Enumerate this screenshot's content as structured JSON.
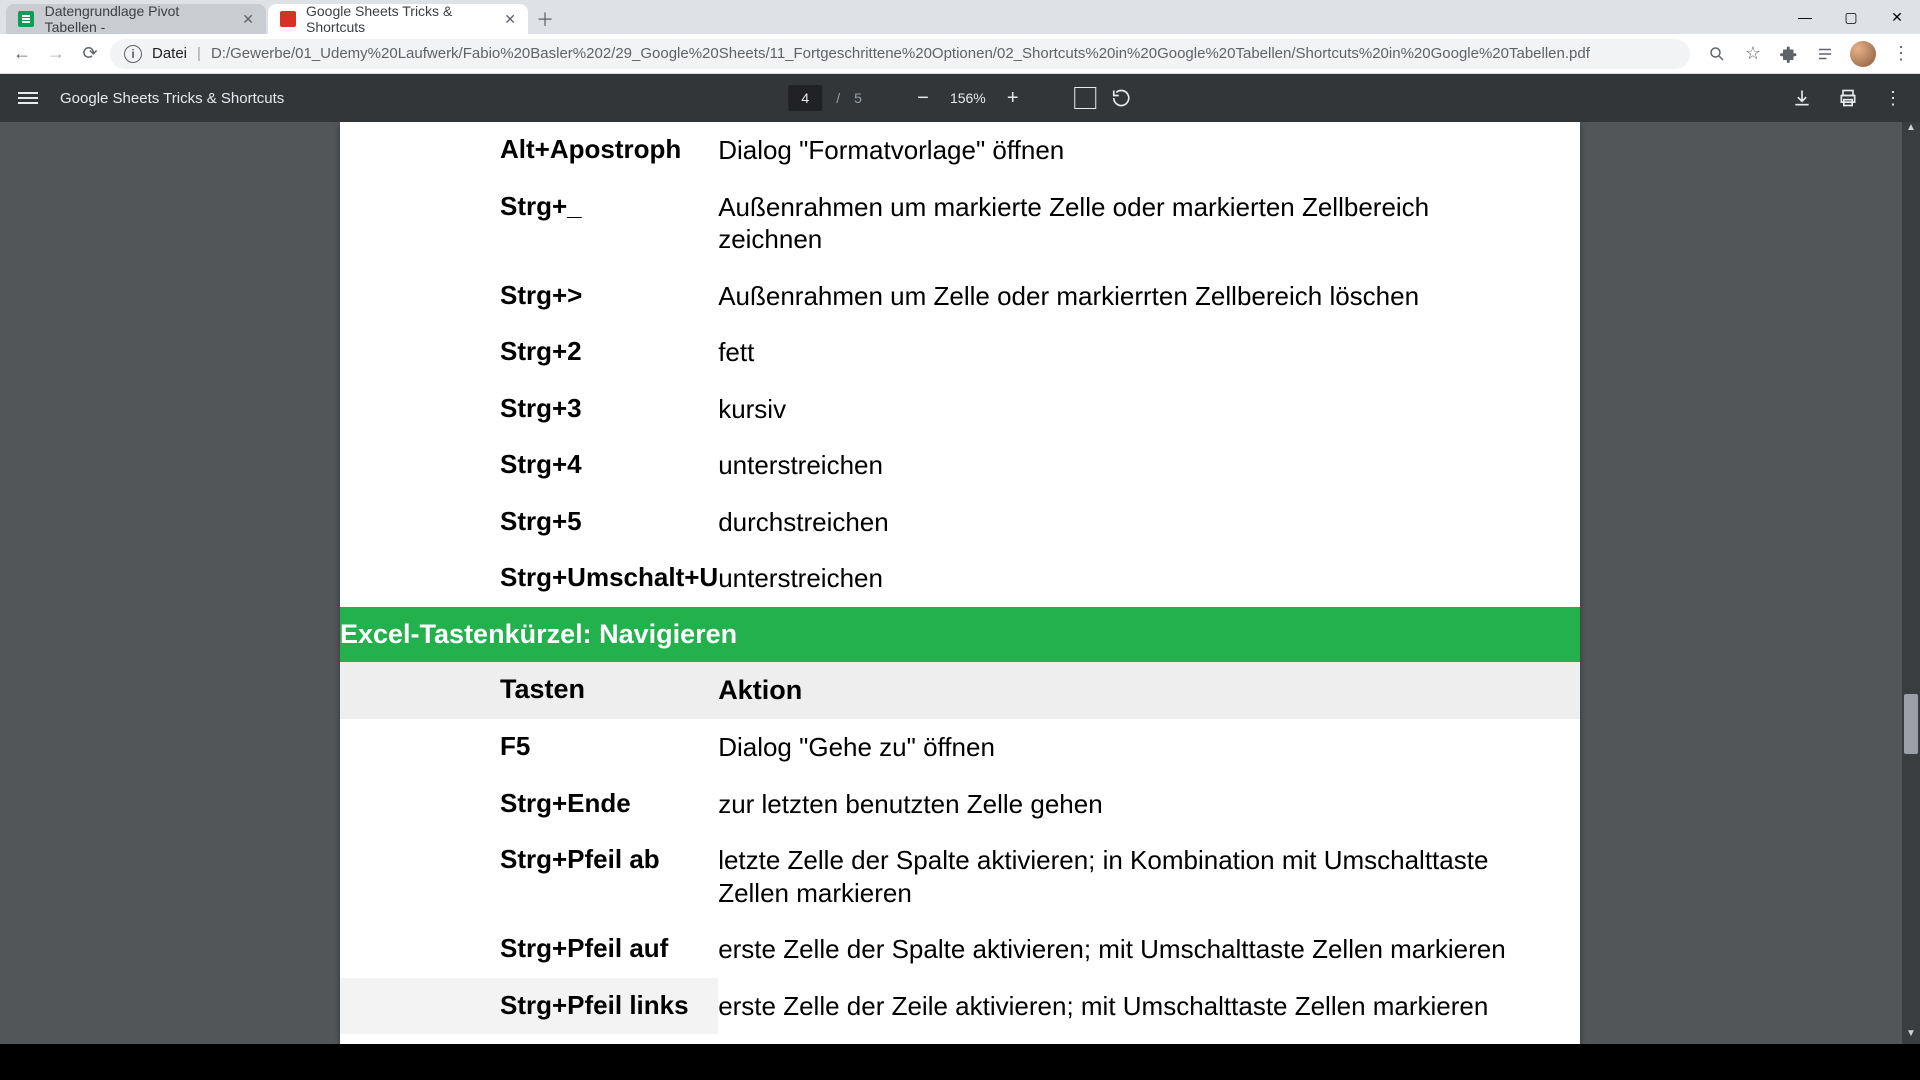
{
  "tabs": [
    {
      "title": "Datengrundlage Pivot Tabellen -",
      "active": false
    },
    {
      "title": "Google Sheets Tricks & Shortcuts",
      "active": true
    }
  ],
  "url": {
    "scheme": "Datei",
    "path": "D:/Gewerbe/01_Udemy%20Laufwerk/Fabio%20Basler%202/29_Google%20Sheets/11_Fortgeschrittene%20Optionen/02_Shortcuts%20in%20Google%20Tabellen/Shortcuts%20in%20Google%20Tabellen.pdf"
  },
  "pdf": {
    "title": "Google Sheets Tricks & Shortcuts",
    "page_current": "4",
    "page_total": "5",
    "zoom": "156%"
  },
  "rows_top": [
    {
      "key": "Alt+Apostroph",
      "desc": "Dialog \"Formatvorlage\" öffnen"
    },
    {
      "key": "Strg+_",
      "desc": "Außenrahmen um markierte Zelle oder markierten Zellbereich zeichnen"
    },
    {
      "key": "Strg+>",
      "desc": "Außenrahmen um Zelle oder markierrten Zellbereich löschen"
    },
    {
      "key": "Strg+2",
      "desc": "fett"
    },
    {
      "key": "Strg+3",
      "desc": "kursiv"
    },
    {
      "key": "Strg+4",
      "desc": "unterstreichen"
    },
    {
      "key": "Strg+5",
      "desc": "durchstreichen"
    },
    {
      "key": "Strg+Umschalt+U",
      "desc": "unterstreichen"
    }
  ],
  "section_header": "Excel-Tastenkürzel: Navigieren",
  "columns": {
    "key": "Tasten",
    "action": "Aktion"
  },
  "rows_nav": [
    {
      "key": "F5",
      "desc": "Dialog \"Gehe zu\" öffnen"
    },
    {
      "key": "Strg+Ende",
      "desc": "zur letzten benutzten Zelle gehen"
    },
    {
      "key": "Strg+Pfeil ab",
      "desc": "letzte Zelle der Spalte aktivieren; in Kombination mit Umschalttaste Zellen markieren"
    },
    {
      "key": "Strg+Pfeil auf",
      "desc": "erste Zelle der Spalte aktivieren; mit Umschalttaste Zellen markieren"
    },
    {
      "key": "Strg+Pfeil links",
      "desc": "erste Zelle der Zeile aktivieren; mit Umschalttaste Zellen markieren"
    }
  ]
}
